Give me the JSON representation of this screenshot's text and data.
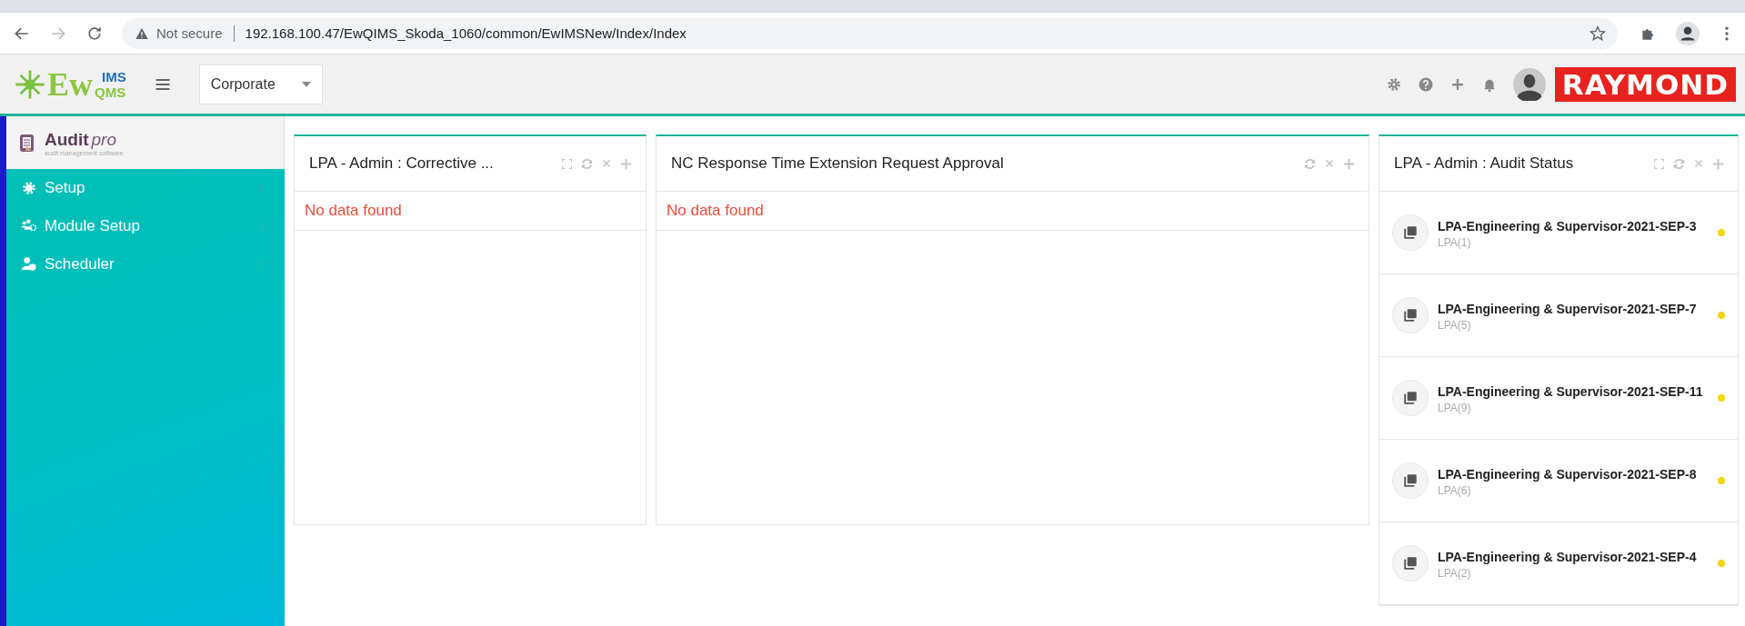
{
  "browser": {
    "security_label": "Not secure",
    "url": "192.168.100.47/EwQIMS_Skoda_1060/common/EwIMSNew/Index/Index"
  },
  "header": {
    "logo": {
      "main": "Ew",
      "top": "IMS",
      "bottom": "QMS"
    },
    "dropdown": {
      "value": "Corporate"
    },
    "brand": "RAYMOND"
  },
  "sidebar": {
    "logo": {
      "title": "Audit",
      "suffix": "pro",
      "tagline": "audit management software"
    },
    "items": [
      {
        "label": "Setup"
      },
      {
        "label": "Module Setup"
      },
      {
        "label": "Scheduler"
      }
    ]
  },
  "panels": [
    {
      "title": "LPA - Admin : Corrective ...",
      "expandable": true,
      "message": "No data found"
    },
    {
      "title": "NC Response Time Extension Request Approval",
      "expandable": false,
      "message": "No data found"
    },
    {
      "title": "LPA - Admin : Audit Status",
      "expandable": true,
      "items": [
        {
          "title": "LPA-Engineering & Supervisor-2021-SEP-3",
          "subtitle": "LPA(1)",
          "color": "#f2d600"
        },
        {
          "title": "LPA-Engineering & Supervisor-2021-SEP-7",
          "subtitle": "LPA(5)",
          "color": "#f2d600"
        },
        {
          "title": "LPA-Engineering & Supervisor-2021-SEP-11",
          "subtitle": "LPA(9)",
          "color": "#f2d600"
        },
        {
          "title": "LPA-Engineering & Supervisor-2021-SEP-8",
          "subtitle": "LPA(6)",
          "color": "#f2d600"
        },
        {
          "title": "LPA-Engineering & Supervisor-2021-SEP-4",
          "subtitle": "LPA(2)",
          "color": "#f2d600"
        }
      ]
    }
  ]
}
